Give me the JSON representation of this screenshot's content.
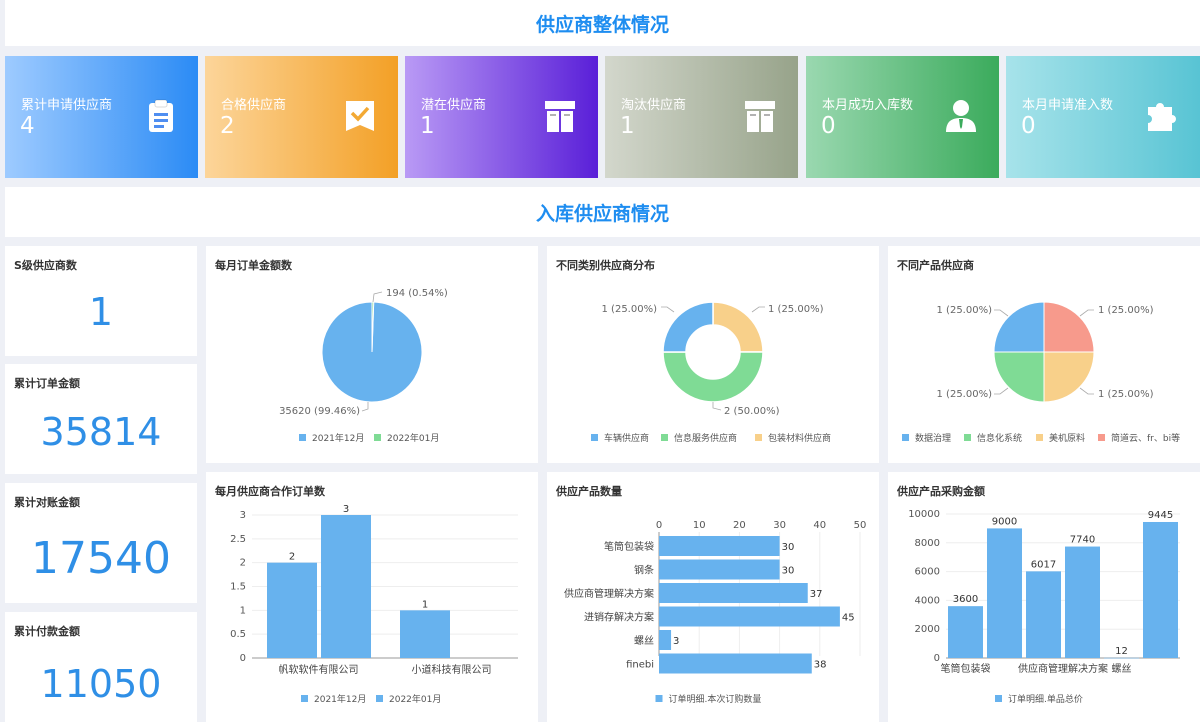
{
  "header": {
    "title": "供应商整体情况"
  },
  "section2": {
    "title": "入库供应商情况"
  },
  "kpis": [
    {
      "label": "累计申请供应商",
      "value": "4",
      "icon": "clipboard-icon",
      "from": "#9ecbff",
      "to": "#2b8bf5"
    },
    {
      "label": "合格供应商",
      "value": "2",
      "icon": "badge-check-icon",
      "from": "#fcd59a",
      "to": "#f3a026"
    },
    {
      "label": "潜在供应商",
      "value": "1",
      "icon": "box-icon",
      "from": "#b99af5",
      "to": "#5a1fd8"
    },
    {
      "label": "淘汰供应商",
      "value": "1",
      "icon": "box-icon",
      "from": "#d3d7cc",
      "to": "#97a38a"
    },
    {
      "label": "本月成功入库数",
      "value": "0",
      "icon": "person-icon",
      "from": "#9ad8b0",
      "to": "#3bab5c"
    },
    {
      "label": "本月申请准入数",
      "value": "0",
      "icon": "puzzle-icon",
      "from": "#a7e3ea",
      "to": "#58c4d4"
    }
  ],
  "stats": [
    {
      "label": "S级供应商数",
      "value": "1"
    },
    {
      "label": "累计订单金额",
      "value": "35814"
    },
    {
      "label": "累计对账金额",
      "value": "17540"
    },
    {
      "label": "累计付款金额",
      "value": "11050"
    }
  ],
  "colors": {
    "blue": "#67b2ee",
    "green": "#7fdb95",
    "yellow": "#f8d08a",
    "red": "#f79a8c"
  },
  "chart_data": [
    {
      "type": "pie",
      "title": "每月订单金额数",
      "labels": [
        "2021年12月",
        "2022年01月"
      ],
      "values": [
        35620,
        194
      ],
      "data_labels": [
        "35620 (99.46%)",
        "194 (0.54%)"
      ],
      "legend": "bottom"
    },
    {
      "type": "pie",
      "donut": true,
      "title": "不同类别供应商分布",
      "labels": [
        "车辆供应商",
        "信息服务供应商",
        "包装材料供应商"
      ],
      "values": [
        1,
        2,
        1
      ],
      "data_labels": [
        "1 (25.00%)",
        "2 (50.00%)",
        "1 (25.00%)"
      ],
      "legend": "bottom"
    },
    {
      "type": "pie",
      "title": "不同产品供应商",
      "labels": [
        "数据治理",
        "信息化系统",
        "美机原料",
        "简道云、fr、bi等"
      ],
      "values": [
        1,
        1,
        1,
        1
      ],
      "data_labels": [
        "1 (25.00%)",
        "1 (25.00%)",
        "1 (25.00%)",
        "1 (25.00%)"
      ],
      "legend": "bottom"
    },
    {
      "type": "bar",
      "title": "每月供应商合作订单数",
      "categories": [
        "帆软软件有限公司",
        "小道科技有限公司"
      ],
      "series": [
        {
          "name": "2021年12月",
          "values": [
            2,
            1
          ]
        },
        {
          "name": "2022年01月",
          "values": [
            3,
            null
          ]
        }
      ],
      "ylim": [
        0,
        3
      ],
      "yticks": [
        "0",
        "0.5",
        "1",
        "1.5",
        "2",
        "2.5",
        "3"
      ],
      "legend": "bottom"
    },
    {
      "type": "bar",
      "orientation": "horizontal",
      "title": "供应产品数量",
      "categories": [
        "笔筒包装袋",
        "钢条",
        "供应商管理解决方案",
        "进销存解决方案",
        "螺丝",
        "finebi"
      ],
      "series": [
        {
          "name": "订单明细.本次订购数量",
          "values": [
            30,
            30,
            37,
            45,
            3,
            38
          ]
        }
      ],
      "xlim": [
        0,
        50
      ],
      "xticks": [
        "0",
        "10",
        "20",
        "30",
        "40",
        "50"
      ],
      "legend": "bottom"
    },
    {
      "type": "bar",
      "title": "供应产品采购金额",
      "categories": [
        "笔筒包装袋",
        "",
        "供应商管理解决方案",
        "",
        "螺丝",
        ""
      ],
      "series": [
        {
          "name": "订单明细.单品总价",
          "values": [
            3600,
            9000,
            6017,
            7740,
            12,
            9445
          ]
        }
      ],
      "ylim": [
        0,
        10000
      ],
      "yticks": [
        "0",
        "2000",
        "4000",
        "6000",
        "8000",
        "10000"
      ],
      "legend": "bottom"
    }
  ]
}
